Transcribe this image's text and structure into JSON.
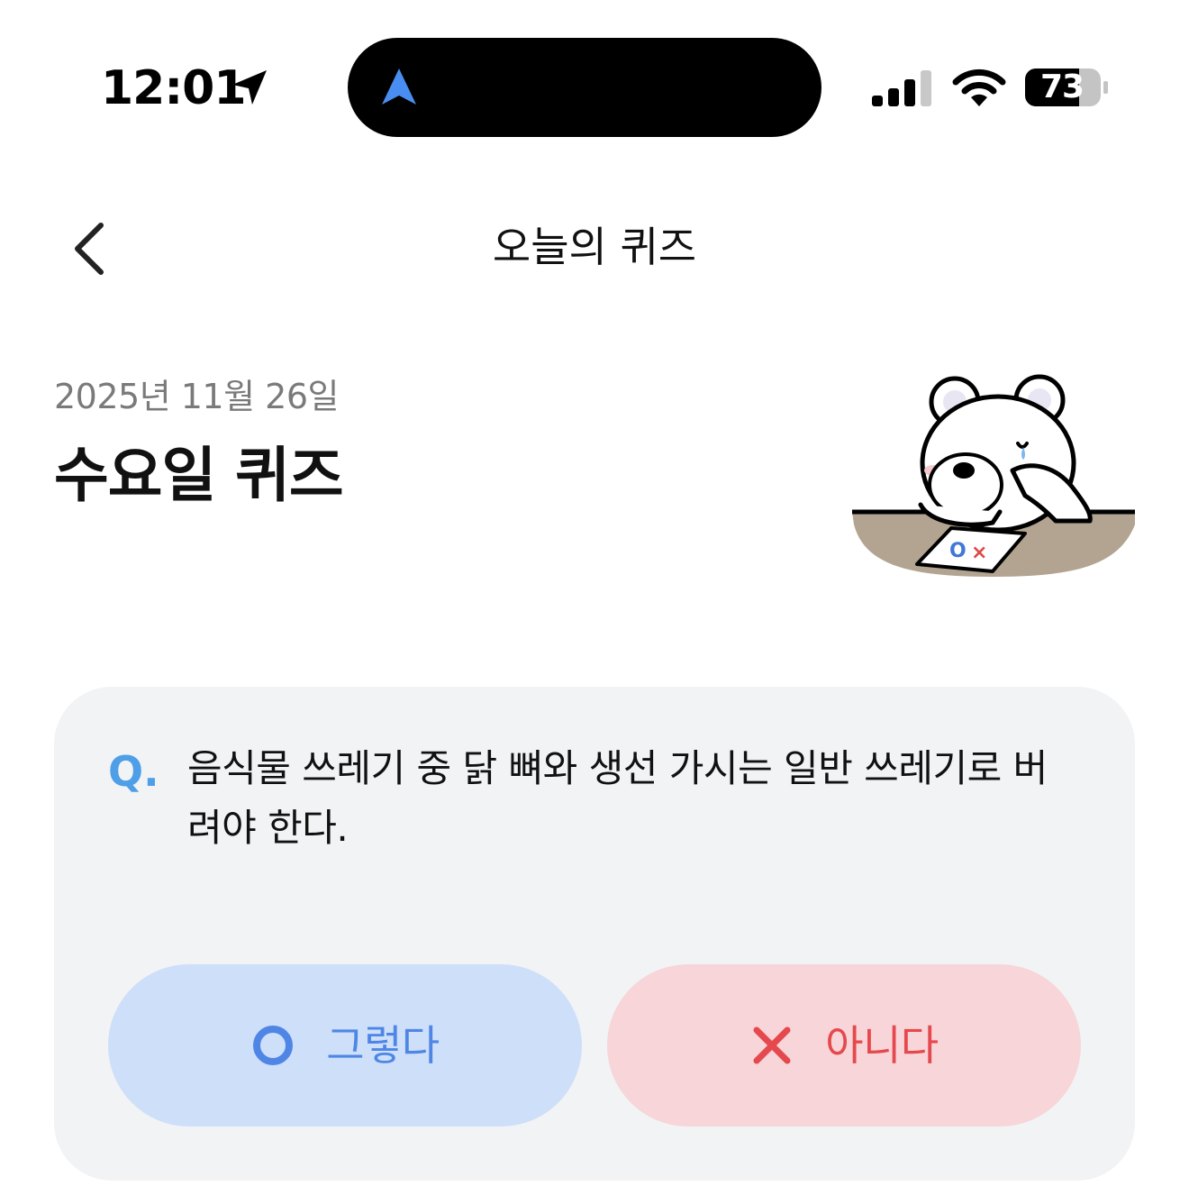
{
  "status_bar": {
    "time": "12:01",
    "battery": "73",
    "icons": [
      "location-arrow-icon",
      "navigation-icon",
      "signal-icon",
      "wifi-icon",
      "battery-icon"
    ]
  },
  "header": {
    "back_icon": "chevron-left-icon",
    "title": "오늘의 퀴즈"
  },
  "quiz": {
    "date": "2025년 11월 26일",
    "day_title": "수요일 퀴즈",
    "question_prefix": "Q.",
    "question": "음식물 쓰레기 중 닭 뼈와 생선 가시는 일반 쓰레기로 버려야 한다.",
    "answers": [
      {
        "label": "그렇다",
        "icon": "circle-o-icon",
        "color": "#4f86e6"
      },
      {
        "label": "아니다",
        "icon": "x-mark-icon",
        "color": "#e5484d"
      }
    ]
  },
  "colors": {
    "card_bg": "#f2f3f5",
    "yes_bg": "#cddff9",
    "no_bg": "#f7d5d8",
    "q_mark": "#4e9ee8"
  }
}
